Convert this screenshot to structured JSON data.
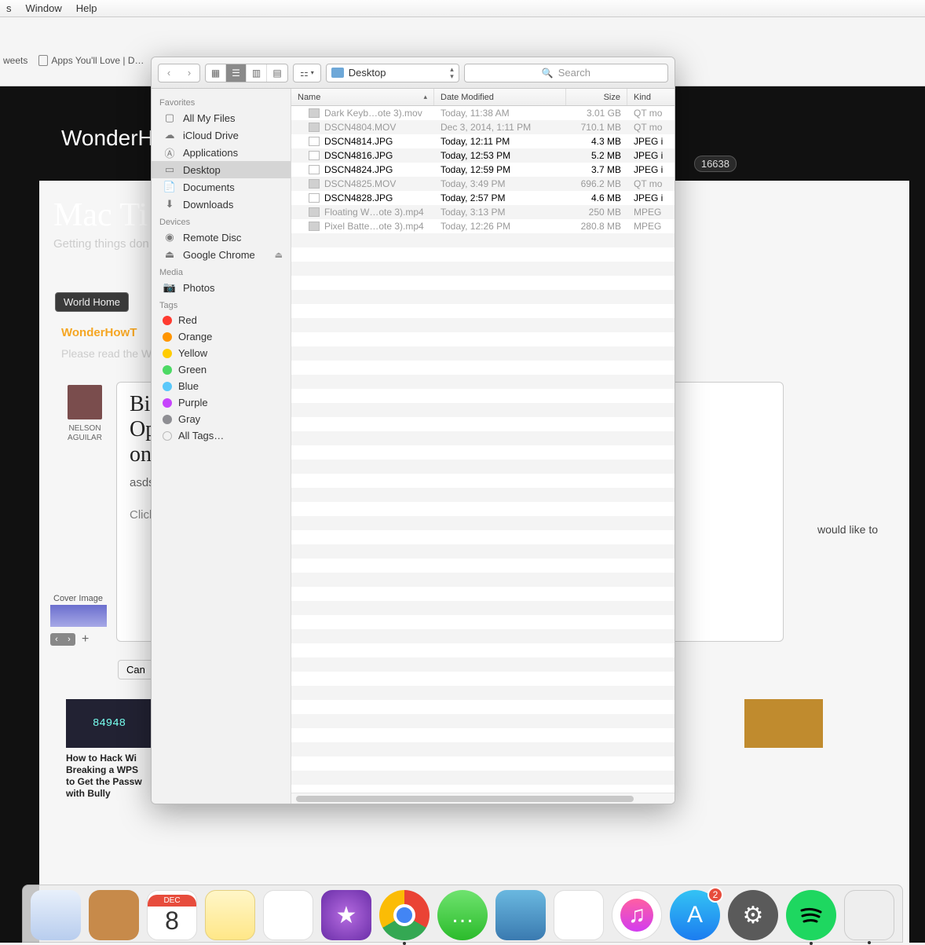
{
  "menubar": {
    "items": [
      "s",
      "Window",
      "Help"
    ]
  },
  "bookmarks": {
    "items": [
      "weets",
      "Apps You'll Love | D…"
    ]
  },
  "background_page": {
    "site_name": "WonderHo",
    "stat_badge": "16638",
    "hero_title": "Mac Ti",
    "hero_sub": "Getting things don",
    "world_home": "World Home",
    "brand_line": "WonderHowT",
    "brand_sub": "Please read the Wi",
    "author_name": "NELSON AGUILAR",
    "post_title": "Big\nOp\non",
    "post_text": "asds",
    "post_click": "Click",
    "side_text": "would like to",
    "cover_label": "Cover Image",
    "pager_plus": "+",
    "cancel_label": "Can",
    "related1_thumb_text": "84948",
    "related1_title": "How to Hack Wi\nBreaking a WPS\nto Get the Passw\nwith Bully"
  },
  "finder": {
    "path_label": "Desktop",
    "search_placeholder": "Search",
    "columns": {
      "name": "Name",
      "date": "Date Modified",
      "size": "Size",
      "kind": "Kind"
    },
    "sidebar": {
      "sections": [
        {
          "header": "Favorites",
          "items": [
            {
              "icon": "all-files",
              "label": "All My Files"
            },
            {
              "icon": "cloud",
              "label": "iCloud Drive"
            },
            {
              "icon": "app",
              "label": "Applications"
            },
            {
              "icon": "desktop",
              "label": "Desktop",
              "selected": true
            },
            {
              "icon": "doc",
              "label": "Documents"
            },
            {
              "icon": "download",
              "label": "Downloads"
            }
          ]
        },
        {
          "header": "Devices",
          "items": [
            {
              "icon": "disc",
              "label": "Remote Disc"
            },
            {
              "icon": "drive",
              "label": "Google Chrome",
              "eject": true
            }
          ]
        },
        {
          "header": "Media",
          "items": [
            {
              "icon": "photos",
              "label": "Photos"
            }
          ]
        },
        {
          "header": "Tags",
          "items": [
            {
              "color": "#ff3b30",
              "label": "Red"
            },
            {
              "color": "#ff9500",
              "label": "Orange"
            },
            {
              "color": "#ffcc00",
              "label": "Yellow"
            },
            {
              "color": "#4cd964",
              "label": "Green"
            },
            {
              "color": "#5ac8fa",
              "label": "Blue"
            },
            {
              "color": "#c644fc",
              "label": "Purple"
            },
            {
              "color": "#8e8e93",
              "label": "Gray"
            },
            {
              "color": "transparent",
              "label": "All Tags…",
              "outline": true
            }
          ]
        }
      ]
    },
    "files": [
      {
        "name": "Dark Keyb…ote 3).mov",
        "date": "Today, 11:38 AM",
        "size": "3.01 GB",
        "kind": "QT mo",
        "dim": true,
        "type": "mov"
      },
      {
        "name": "DSCN4804.MOV",
        "date": "Dec 3, 2014, 1:11 PM",
        "size": "710.1 MB",
        "kind": "QT mo",
        "dim": true,
        "type": "mov"
      },
      {
        "name": "DSCN4814.JPG",
        "date": "Today, 12:11 PM",
        "size": "4.3 MB",
        "kind": "JPEG i",
        "dim": false,
        "type": "img"
      },
      {
        "name": "DSCN4816.JPG",
        "date": "Today, 12:53 PM",
        "size": "5.2 MB",
        "kind": "JPEG i",
        "dim": false,
        "type": "img"
      },
      {
        "name": "DSCN4824.JPG",
        "date": "Today, 12:59 PM",
        "size": "3.7 MB",
        "kind": "JPEG i",
        "dim": false,
        "type": "img"
      },
      {
        "name": "DSCN4825.MOV",
        "date": "Today, 3:49 PM",
        "size": "696.2 MB",
        "kind": "QT mo",
        "dim": true,
        "type": "mov"
      },
      {
        "name": "DSCN4828.JPG",
        "date": "Today, 2:57 PM",
        "size": "4.6 MB",
        "kind": "JPEG i",
        "dim": false,
        "type": "img"
      },
      {
        "name": "Floating W…ote 3).mp4",
        "date": "Today, 3:13 PM",
        "size": "250 MB",
        "kind": "MPEG",
        "dim": true,
        "type": "mov"
      },
      {
        "name": "Pixel Batte…ote 3).mp4",
        "date": "Today, 12:26 PM",
        "size": "280.8 MB",
        "kind": "MPEG",
        "dim": true,
        "type": "mov"
      }
    ]
  },
  "dock": {
    "calendar": {
      "month": "DEC",
      "day": "8"
    },
    "appstore_badge": "2",
    "items": [
      {
        "name": "mail",
        "running": false
      },
      {
        "name": "contacts",
        "running": false
      },
      {
        "name": "calendar",
        "running": false
      },
      {
        "name": "notes",
        "running": false
      },
      {
        "name": "reminders",
        "running": false
      },
      {
        "name": "imovie",
        "running": false
      },
      {
        "name": "chrome",
        "running": true
      },
      {
        "name": "messages",
        "running": false
      },
      {
        "name": "photobooth",
        "running": false
      },
      {
        "name": "pages",
        "running": false
      },
      {
        "name": "itunes",
        "running": false
      },
      {
        "name": "appstore",
        "running": false
      },
      {
        "name": "settings",
        "running": false
      },
      {
        "name": "spotify",
        "running": true
      },
      {
        "name": "app",
        "running": true
      }
    ]
  }
}
